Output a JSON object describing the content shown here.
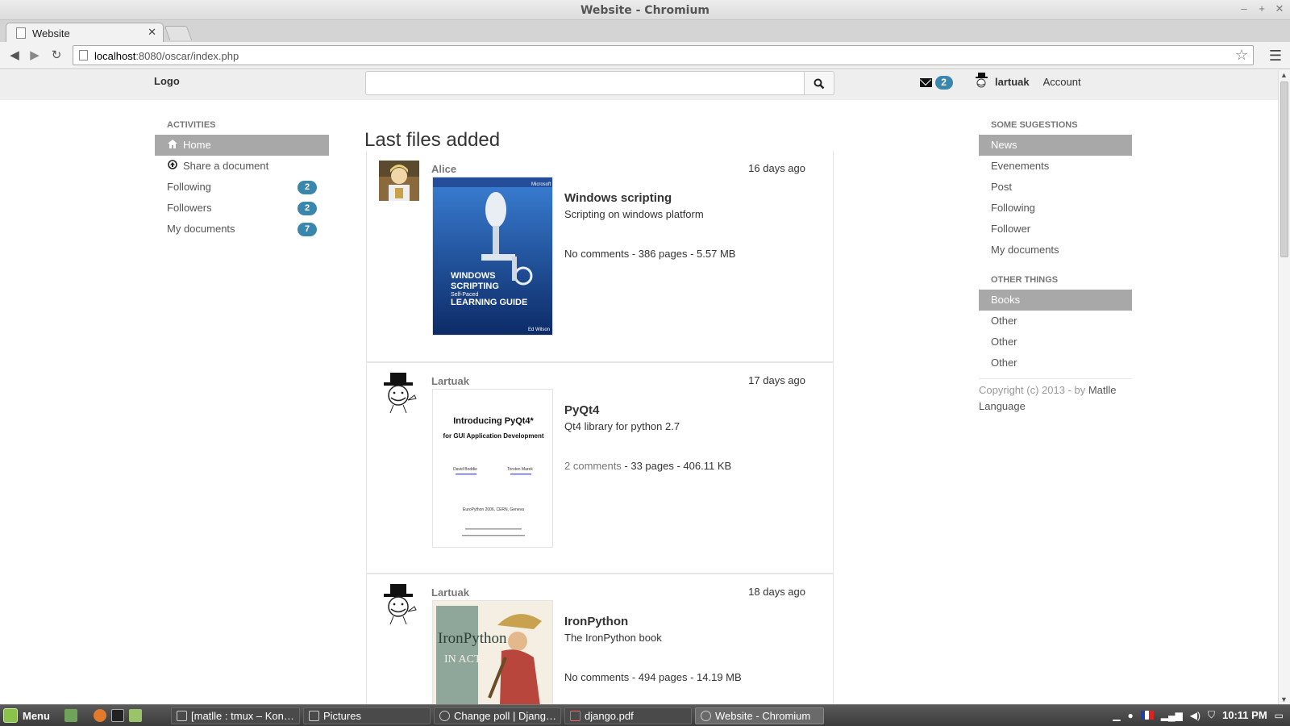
{
  "window": {
    "title": "Website - Chromium",
    "controls": [
      "–",
      "+",
      "✕"
    ]
  },
  "browser": {
    "tab_title": "Website",
    "url_host": "localhost",
    "url_rest": ":8080/oscar/index.php"
  },
  "header": {
    "logo": "Logo",
    "search_placeholder": "",
    "message_count": "2",
    "username": "lartuak",
    "account": "Account"
  },
  "left_nav": {
    "heading": "ACTIVITIES",
    "items": [
      {
        "label": "Home",
        "icon": "home-icon",
        "active": true
      },
      {
        "label": "Share a document",
        "icon": "upload-circle-icon"
      },
      {
        "label": "Following",
        "badge": "2"
      },
      {
        "label": "Followers",
        "badge": "2"
      },
      {
        "label": "My documents",
        "badge": "7"
      }
    ]
  },
  "main": {
    "title": "Last files added",
    "posts": [
      {
        "author": "Alice",
        "date": "16 days ago",
        "book_title": "Windows scripting",
        "description": "Scripting on windows platform",
        "comments": "No comments",
        "meta": " - 386 pages - 5.57 MB",
        "cover_lines": [
          "Microsoft",
          "WINDOWS",
          "SCRIPTING",
          "Self-Paced",
          "LEARNING GUIDE",
          "Ed Wilson"
        ]
      },
      {
        "author": "Lartuak",
        "date": "17 days ago",
        "book_title": "PyQt4",
        "description": "Qt4 library for python 2.7",
        "comments": "2 comments",
        "meta": " - 33 pages - 406.11 KB",
        "cover_lines": [
          "Introducing PyQt4*",
          "for GUI Application Development",
          "David Boddie",
          "Torsten Marek",
          "EuroPython 2006, CERN, Geneva"
        ]
      },
      {
        "author": "Lartuak",
        "date": "18 days ago",
        "book_title": "IronPython",
        "description": "The IronPython book",
        "comments": "No comments",
        "meta": " - 494 pages - 14.19 MB",
        "cover_lines": [
          "IronPython",
          "IN ACTION"
        ]
      }
    ]
  },
  "right_nav": {
    "heading1": "SOME SUGESTIONS",
    "items1": [
      {
        "label": "News",
        "active": true
      },
      {
        "label": "Evenements"
      },
      {
        "label": "Post"
      },
      {
        "label": "Following"
      },
      {
        "label": "Follower"
      },
      {
        "label": "My documents"
      }
    ],
    "heading2": "OTHER THINGS",
    "items2": [
      {
        "label": "Books",
        "active": true
      },
      {
        "label": "Other"
      },
      {
        "label": "Other"
      },
      {
        "label": "Other"
      }
    ],
    "copyright": "Copyright (c) 2013 - by ",
    "author_link": "Matlle",
    "language": "Language"
  },
  "taskbar": {
    "menu_label": "Menu",
    "tasks": [
      {
        "label": "[matlle : tmux – Kon…"
      },
      {
        "label": "Pictures"
      },
      {
        "label": "Change poll | Djang…"
      },
      {
        "label": "django.pdf"
      },
      {
        "label": "Website - Chromium",
        "active": true
      }
    ],
    "clock": "10:11 PM"
  },
  "colors": {
    "badge": "#3a87ad",
    "active_nav": "#a8a8a8",
    "header_bg": "#eeeeee"
  }
}
